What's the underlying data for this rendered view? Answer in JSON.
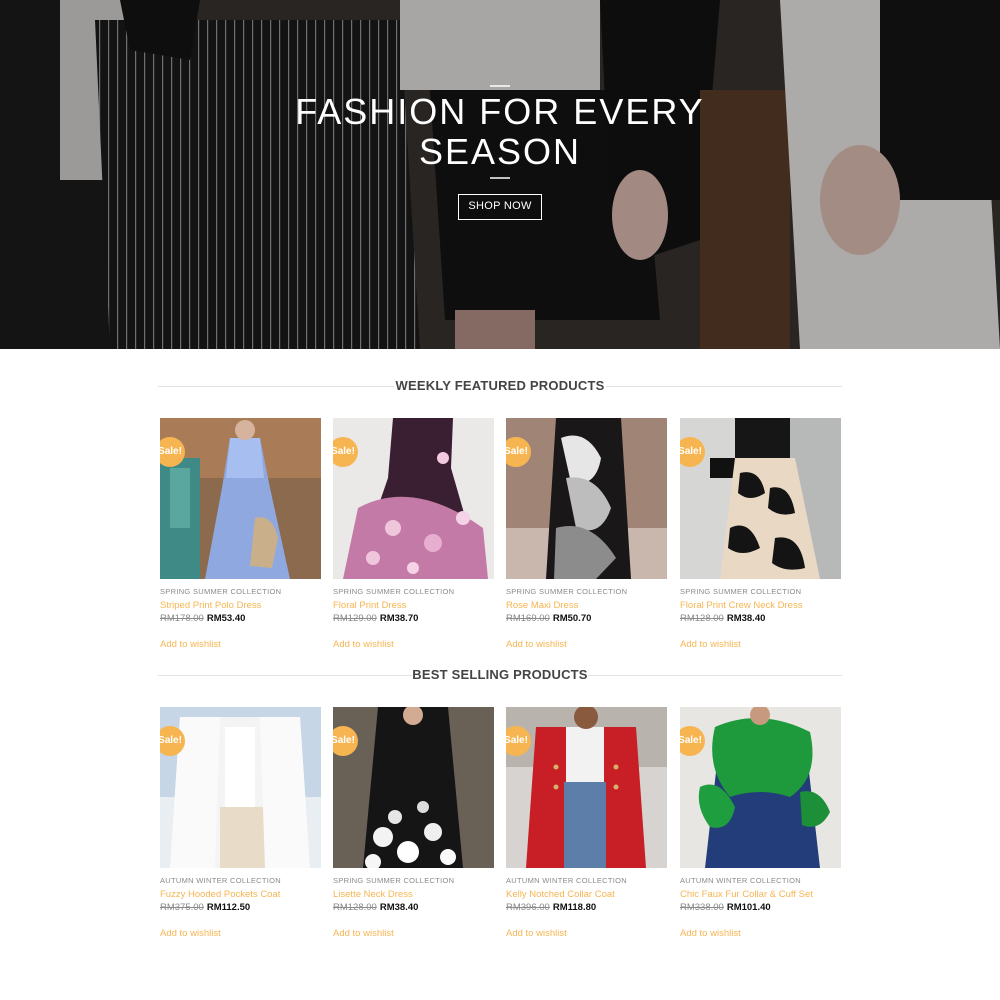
{
  "hero": {
    "title": "FASHION FOR EVERY SEASON",
    "button_label": "SHOP NOW"
  },
  "sections": {
    "featured_title": "WEEKLY FEATURED PRODUCTS",
    "bestselling_title": "BEST SELLING PRODUCTS"
  },
  "colors": {
    "accent": "#f7b551",
    "sale_badge": "#f7b551",
    "text_dark": "#111111",
    "muted": "#8a8a8a"
  },
  "featured": [
    {
      "badge": "Sale!",
      "category": "SPRING SUMMER COLLECTION",
      "name": "Striped Print Polo Dress",
      "old_price": "RM178.00",
      "new_price": "RM53.40",
      "wishlist": "Add to wishlist"
    },
    {
      "badge": "Sale!",
      "category": "SPRING SUMMER COLLECTION",
      "name": "Floral Print Dress",
      "old_price": "RM129.00",
      "new_price": "RM38.70",
      "wishlist": "Add to wishlist"
    },
    {
      "badge": "Sale!",
      "category": "SPRING SUMMER COLLECTION",
      "name": "Rose Maxi Dress",
      "old_price": "RM169.00",
      "new_price": "RM50.70",
      "wishlist": "Add to wishlist"
    },
    {
      "badge": "Sale!",
      "category": "SPRING SUMMER COLLECTION",
      "name": "Floral Print Crew Neck Dress",
      "old_price": "RM128.00",
      "new_price": "RM38.40",
      "wishlist": "Add to wishlist"
    }
  ],
  "bestselling": [
    {
      "badge": "Sale!",
      "category": "AUTUMN WINTER COLLECTION",
      "name": "Fuzzy Hooded Pockets Coat",
      "old_price": "RM375.00",
      "new_price": "RM112.50",
      "wishlist": "Add to wishlist"
    },
    {
      "badge": "Sale!",
      "category": "SPRING SUMMER COLLECTION",
      "name": "Lisette Neck Dress",
      "old_price": "RM128.00",
      "new_price": "RM38.40",
      "wishlist": "Add to wishlist"
    },
    {
      "badge": "Sale!",
      "category": "AUTUMN WINTER COLLECTION",
      "name": "Kelly Notched Collar Coat",
      "old_price": "RM396.00",
      "new_price": "RM118.80",
      "wishlist": "Add to wishlist"
    },
    {
      "badge": "Sale!",
      "category": "AUTUMN WINTER COLLECTION",
      "name": "Chic Faux Fur Collar & Cuff Set",
      "old_price": "RM338.00",
      "new_price": "RM101.40",
      "wishlist": "Add to wishlist"
    }
  ]
}
